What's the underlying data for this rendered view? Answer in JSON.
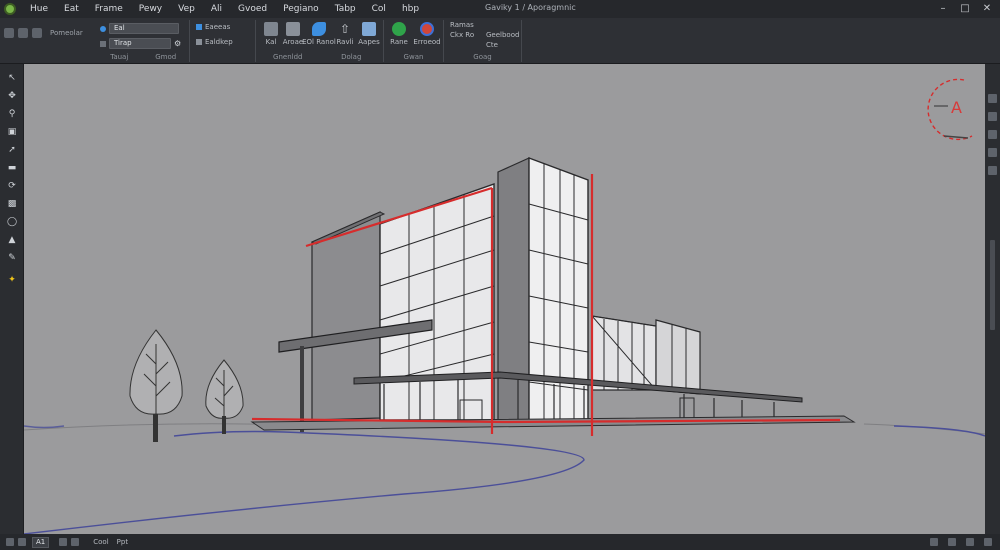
{
  "menubar": {
    "items": [
      "Hue",
      "Eat",
      "Frame",
      "Pewy",
      "Vep",
      "Ali",
      "Gvoed",
      "Pegiano",
      "Tabp",
      "Col",
      "hbp"
    ],
    "document_title": "Gaviky 1 / Aporagmnic"
  },
  "ribbon": {
    "quick_label": "Pomeolar",
    "dropdown1": "Eal",
    "dropdown2": "Tirap",
    "option1": "Eaeeas",
    "option2": "Ealdkep",
    "groups": [
      "Tauaj",
      "Gmod",
      "Gnenldd",
      "Dolag",
      "Gwan",
      "Goag"
    ],
    "tools": [
      {
        "label": "Kal",
        "icon": "cube-icon",
        "color": "#7f8690"
      },
      {
        "label": "Aroae",
        "icon": "shape-icon",
        "color": "#8a9099"
      },
      {
        "label": "EOl Ranol",
        "icon": "blue-shape-icon",
        "color": "#3d8fe0"
      },
      {
        "label": "Ravli",
        "icon": "arrow-up-icon",
        "color": "#c3c7cc"
      },
      {
        "label": "Aapes",
        "icon": "layers-icon",
        "color": "#7fa8d6"
      },
      {
        "label": "Rane",
        "icon": "green-blob-icon",
        "color": "#2fa34a"
      },
      {
        "label": "Erroeod",
        "icon": "render-icon",
        "color": "#d0463a"
      }
    ],
    "side_options": [
      "Ramas",
      "Ckx Ro",
      "Geelbood",
      "Cte"
    ]
  },
  "statusbar": {
    "items": [
      "A1",
      "Cool",
      "Ppt"
    ]
  },
  "canvas": {
    "compass_letter": "A"
  },
  "colors": {
    "accent_red": "#d62c2c",
    "canvas_bg": "#9b9b9d"
  }
}
